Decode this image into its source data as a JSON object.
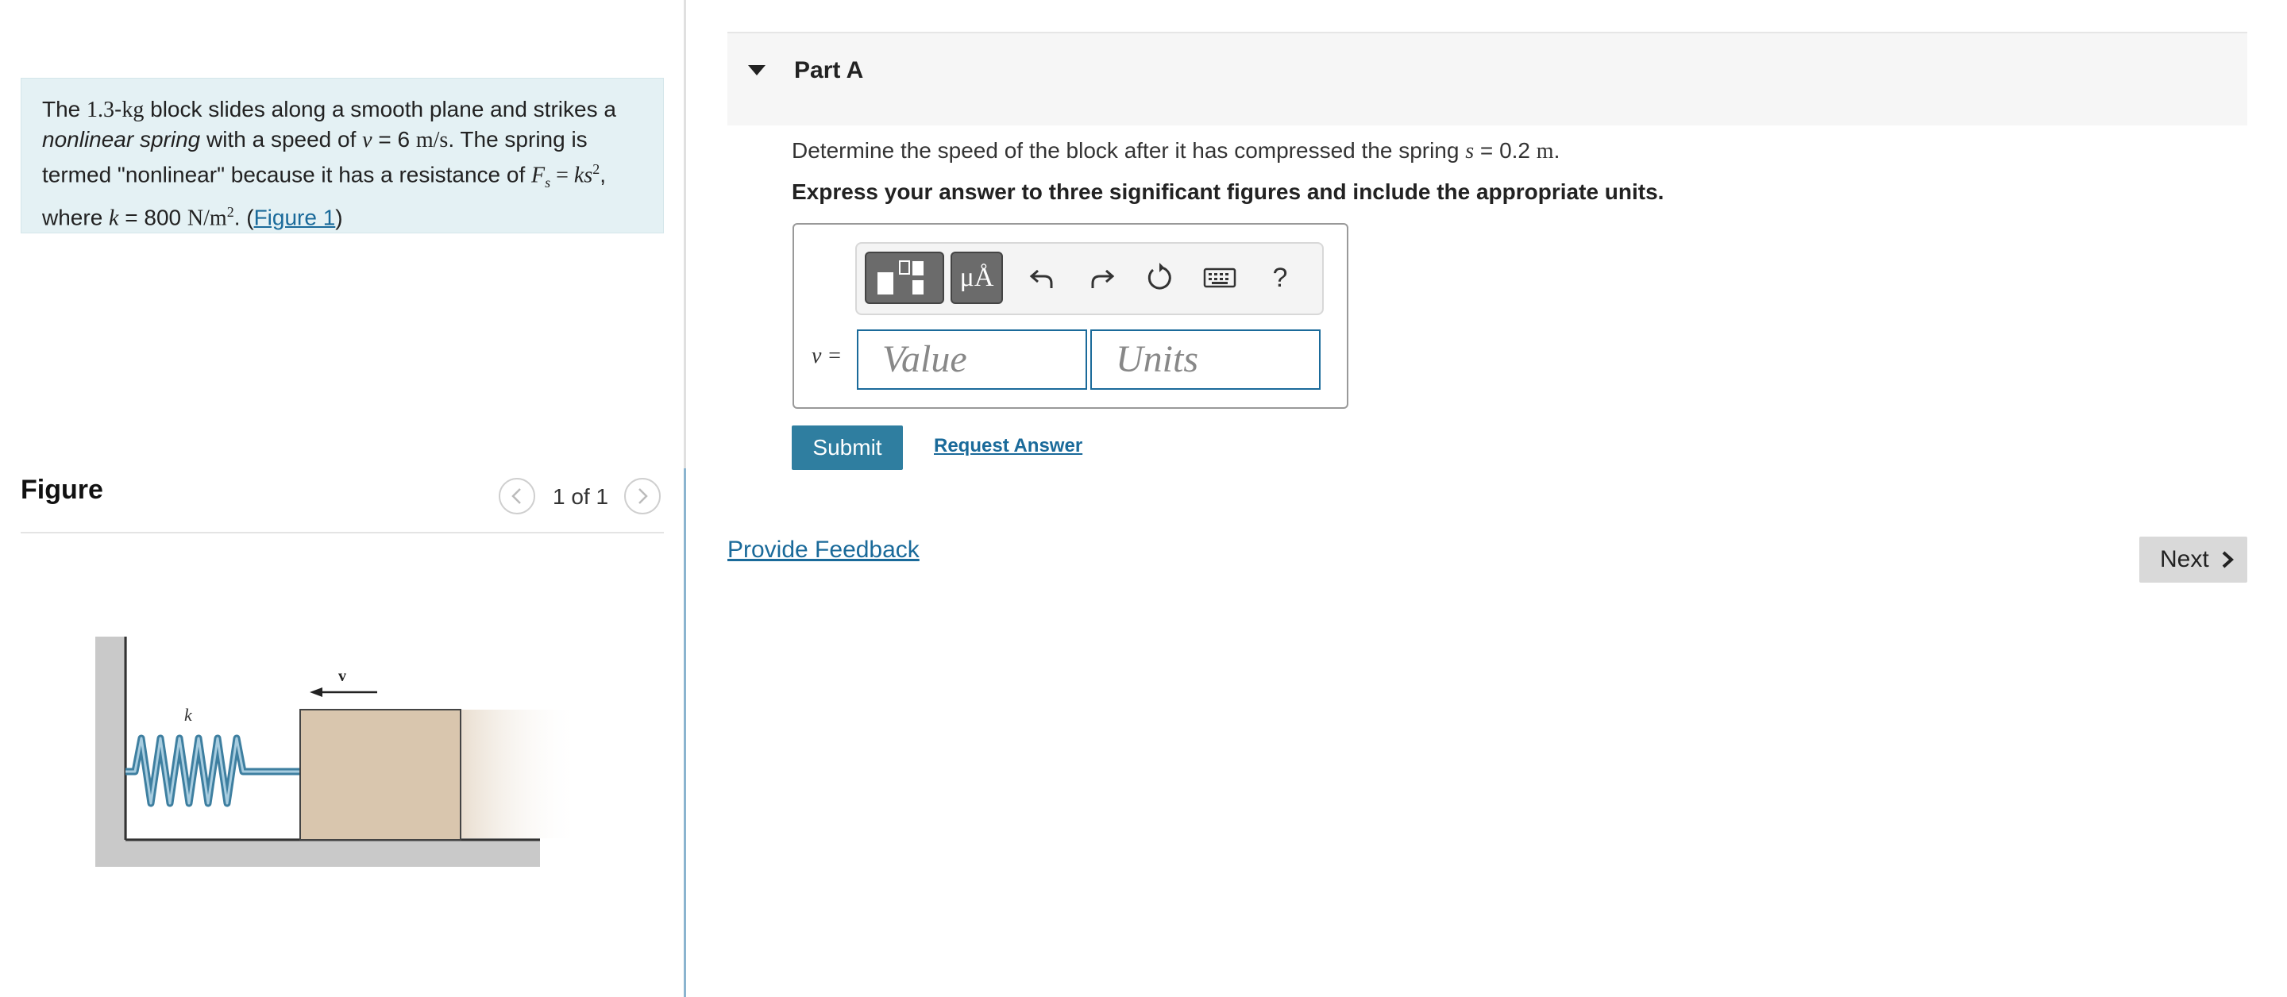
{
  "problem": {
    "t1": "The ",
    "mass": "1.3",
    "mass_unit": "kg",
    "t2": " block slides along a smooth plane and strikes a ",
    "spring_term": "nonlinear spring",
    "t3": " with a speed of ",
    "speed_var": "v",
    "speed_eq": " = ",
    "speed_val": "6",
    "speed_unit": "m/s",
    "t4": ". The spring is termed \"nonlinear\" because it has a resistance of ",
    "force_var": "F",
    "force_sub": "s",
    "force_eq": " = ",
    "force_rhs": "ks",
    "force_exp": "2",
    "t5": ", where ",
    "k_var": "k",
    "k_eq": " = ",
    "k_val": "800",
    "k_unit": "N/m",
    "k_unit_exp": "2",
    "t6": ". (",
    "figure_link": "Figure 1",
    "t7": ")"
  },
  "figure": {
    "title": "Figure",
    "counter": "1 of 1",
    "label_k": "k",
    "label_v": "v"
  },
  "part": {
    "title": "Part A",
    "question_text": "Determine the speed of the block after it has compressed the spring ",
    "question_var": "s",
    "question_eq": " = ",
    "question_val": "0.2",
    "question_unit": "m",
    "question_end": ".",
    "instruction": "Express your answer to three significant figures and include the appropriate units."
  },
  "toolbar": {
    "symbols_label": "μÅ",
    "help_label": "?"
  },
  "answer": {
    "var_label": "v =",
    "value_placeholder": "Value",
    "units_placeholder": "Units"
  },
  "actions": {
    "submit": "Submit",
    "request_answer": "Request Answer",
    "provide_feedback": "Provide Feedback",
    "next": "Next"
  },
  "colors": {
    "problem_bg": "#e4f1f4",
    "link": "#1a6a9a",
    "submit_bg": "#2f7ea0",
    "block_fill": "#d9c6ae",
    "spring": "#3e7fa0"
  }
}
